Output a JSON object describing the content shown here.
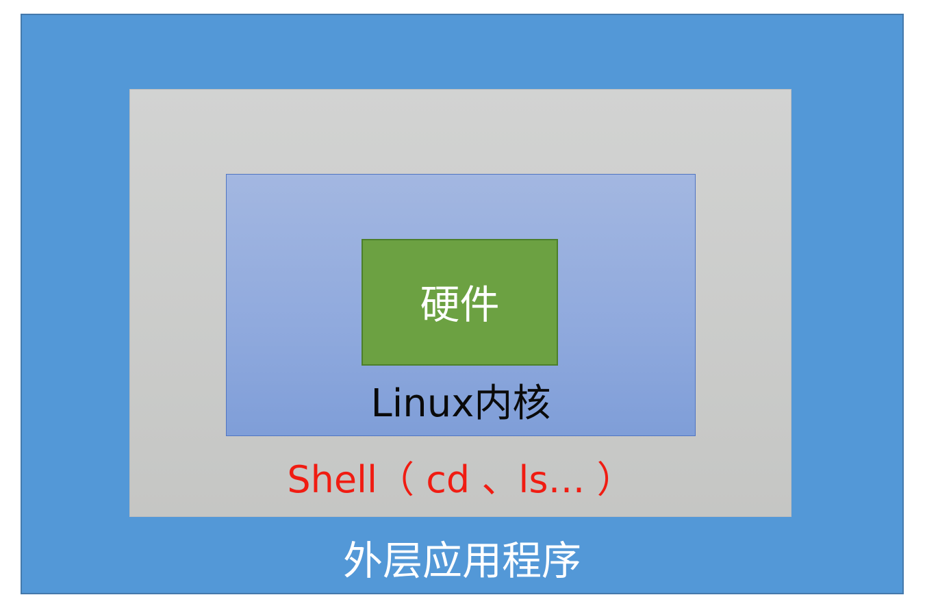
{
  "layers": {
    "app": {
      "label": "外层应用程序",
      "color": "#5398d7"
    },
    "shell": {
      "label": "Shell（ cd 、ls… ）",
      "color": "#d2d3d2"
    },
    "kernel": {
      "label": "Linux内核",
      "color": "#8fa9dd"
    },
    "hardware": {
      "label": "硬件",
      "color": "#6ca142"
    }
  }
}
